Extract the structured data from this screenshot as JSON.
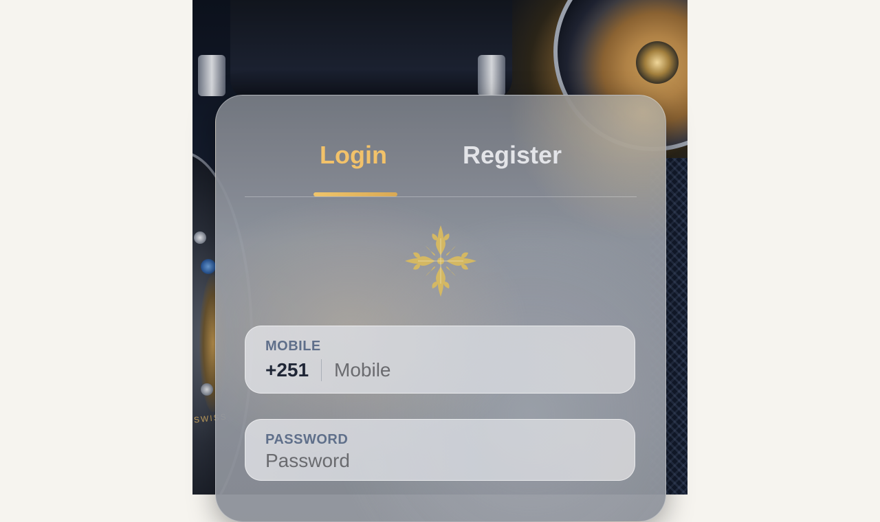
{
  "tabs": {
    "login_label": "Login",
    "register_label": "Register",
    "active": "Login"
  },
  "logo": {
    "icon": "calatrava-cross-icon",
    "color": "#d4b863"
  },
  "mobile_field": {
    "label": "MOBILE",
    "country_code": "+251",
    "value": "",
    "placeholder": "Mobile"
  },
  "password_field": {
    "label": "PASSWORD",
    "value": "",
    "placeholder": "Password"
  },
  "colors": {
    "accent": "#f2c26a",
    "page_background": "#f6f4ef",
    "label": "#5f6f8a"
  },
  "background": {
    "engraving_text": "SWISS"
  }
}
